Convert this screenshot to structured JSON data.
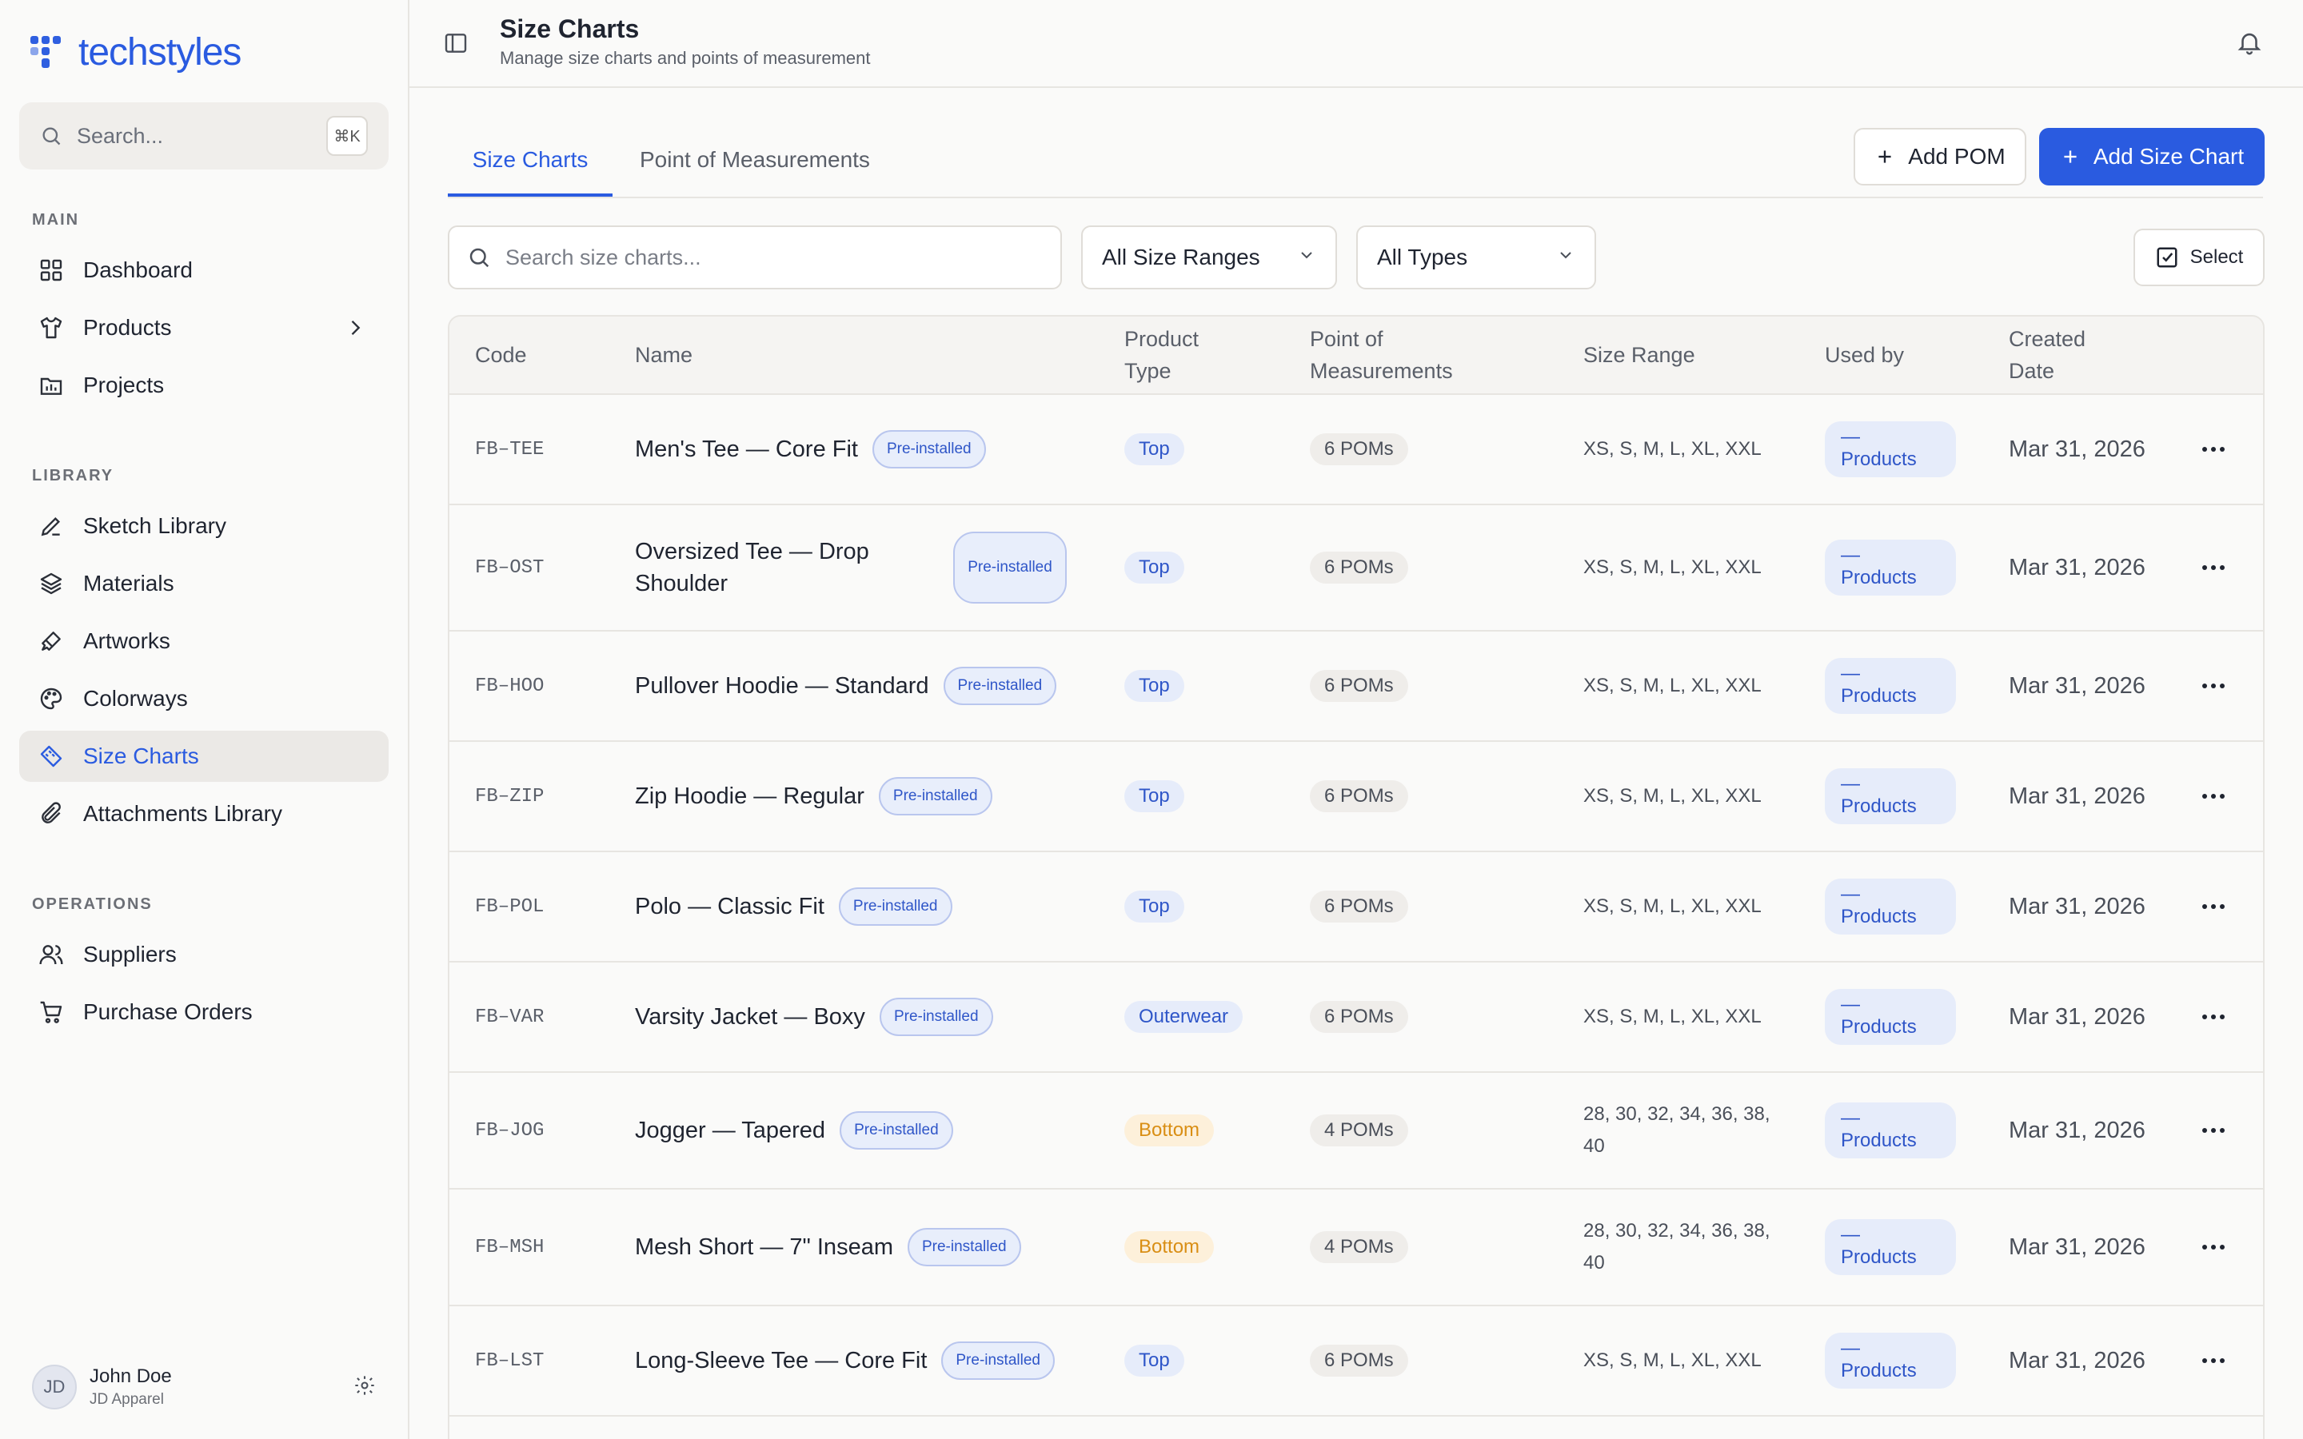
{
  "brand": {
    "name": "techstyles"
  },
  "sidebar": {
    "search_placeholder": "Search...",
    "search_shortcut": "⌘K",
    "sections": [
      {
        "label": "MAIN",
        "items": [
          {
            "label": "Dashboard",
            "icon": "dashboard-icon"
          },
          {
            "label": "Products",
            "icon": "shirt-icon",
            "has_chevron": true
          },
          {
            "label": "Projects",
            "icon": "folder-icon"
          }
        ]
      },
      {
        "label": "LIBRARY",
        "items": [
          {
            "label": "Sketch Library",
            "icon": "pencil-icon"
          },
          {
            "label": "Materials",
            "icon": "layers-icon"
          },
          {
            "label": "Artworks",
            "icon": "brush-icon"
          },
          {
            "label": "Colorways",
            "icon": "palette-icon"
          },
          {
            "label": "Size Charts",
            "icon": "ruler-icon",
            "active": true
          },
          {
            "label": "Attachments Library",
            "icon": "paperclip-icon"
          }
        ]
      },
      {
        "label": "OPERATIONS",
        "items": [
          {
            "label": "Suppliers",
            "icon": "users-icon"
          },
          {
            "label": "Purchase Orders",
            "icon": "cart-icon"
          }
        ]
      }
    ],
    "user": {
      "initials": "JD",
      "name": "John Doe",
      "org": "JD Apparel"
    }
  },
  "header": {
    "title": "Size Charts",
    "subtitle": "Manage size charts and points of measurement"
  },
  "tabs": [
    {
      "label": "Size Charts",
      "active": true
    },
    {
      "label": "Point of Measurements",
      "active": false
    }
  ],
  "actions": {
    "add_pom": "Add POM",
    "add_size_chart": "Add Size Chart"
  },
  "filters": {
    "search_placeholder": "Search size charts...",
    "size_range": "All Size Ranges",
    "type": "All Types",
    "select_label": "Select"
  },
  "table": {
    "columns": {
      "code": "Code",
      "name": "Name",
      "product_type_1": "Product",
      "product_type_2": "Type",
      "pom_1": "Point of",
      "pom_2": "Measurements",
      "size_range": "Size Range",
      "used_by": "Used by",
      "created_1": "Created",
      "created_2": "Date"
    },
    "badge_label": "Pre-installed",
    "badge_wrap_1": "Pre-",
    "badge_wrap_2": "installed",
    "used_dash": "—",
    "used_label": "Products",
    "rows": [
      {
        "code": "FB–TEE",
        "name": "Men's Tee — Core Fit",
        "type": "Top",
        "poms": "6 POMs",
        "sizes": "XS, S, M, L, XL, XXL",
        "date": "Mar 31, 2026"
      },
      {
        "code": "FB–OST",
        "name_1": "Oversized Tee — Drop",
        "name_2": "Shoulder",
        "type": "Top",
        "poms": "6 POMs",
        "sizes": "XS, S, M, L, XL, XXL",
        "date": "Mar 31, 2026"
      },
      {
        "code": "FB–HOO",
        "name": "Pullover Hoodie — Standard",
        "type": "Top",
        "poms": "6 POMs",
        "sizes": "XS, S, M, L, XL, XXL",
        "date": "Mar 31, 2026"
      },
      {
        "code": "FB–ZIP",
        "name": "Zip Hoodie — Regular",
        "type": "Top",
        "poms": "6 POMs",
        "sizes": "XS, S, M, L, XL, XXL",
        "date": "Mar 31, 2026"
      },
      {
        "code": "FB–POL",
        "name": "Polo — Classic Fit",
        "type": "Top",
        "poms": "6 POMs",
        "sizes": "XS, S, M, L, XL, XXL",
        "date": "Mar 31, 2026"
      },
      {
        "code": "FB–VAR",
        "name": "Varsity Jacket — Boxy",
        "type": "Outerwear",
        "poms": "6 POMs",
        "sizes": "XS, S, M, L, XL, XXL",
        "date": "Mar 31, 2026"
      },
      {
        "code": "FB–JOG",
        "name": "Jogger — Tapered",
        "type": "Bottom",
        "poms": "4 POMs",
        "sizes_1": "28, 30, 32, 34, 36, 38,",
        "sizes_2": "40",
        "date": "Mar 31, 2026"
      },
      {
        "code": "FB–MSH",
        "name": "Mesh Short — 7\" Inseam",
        "type": "Bottom",
        "poms": "4 POMs",
        "sizes_1": "28, 30, 32, 34, 36, 38,",
        "sizes_2": "40",
        "date": "Mar 31, 2026"
      },
      {
        "code": "FB–LST",
        "name": "Long-Sleeve Tee — Core Fit",
        "type": "Top",
        "poms": "6 POMs",
        "sizes": "XS, S, M, L, XL, XXL",
        "date": "Mar 31, 2026"
      }
    ]
  },
  "colors": {
    "accent": "#2a5be0",
    "bottom": "#d98e14"
  }
}
